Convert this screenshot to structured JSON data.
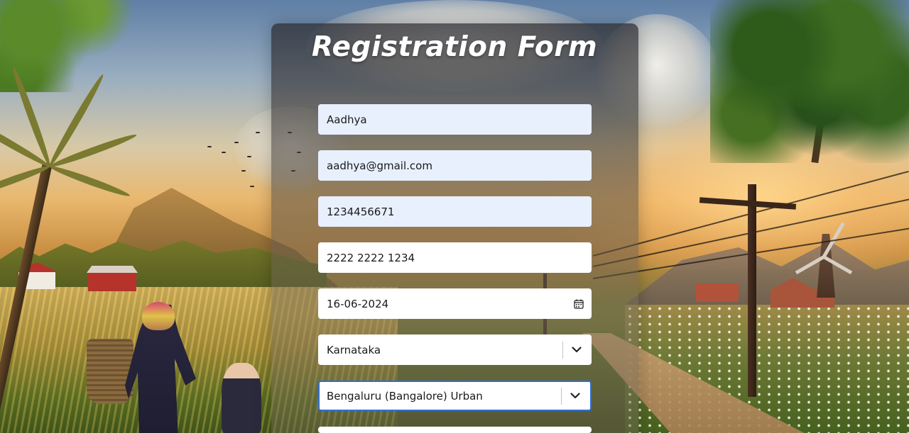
{
  "form": {
    "title": "Registration Form",
    "fields": {
      "name": {
        "value": "Aadhya"
      },
      "email": {
        "value": "aadhya@gmail.com"
      },
      "phone": {
        "value": "1234456671"
      },
      "aadhaar": {
        "value": "2222 2222 1234"
      },
      "dob": {
        "value": "16-06-2024"
      },
      "state": {
        "value": "Karnataka"
      },
      "district": {
        "value": "Bengaluru (Bangalore) Urban"
      }
    }
  },
  "colors": {
    "autofill_bg": "#e8f0fe",
    "focus_border": "#2f6fd1",
    "title_text": "#ffffff"
  },
  "icons": {
    "date": "calendar-icon",
    "select": "chevron-down-icon"
  }
}
